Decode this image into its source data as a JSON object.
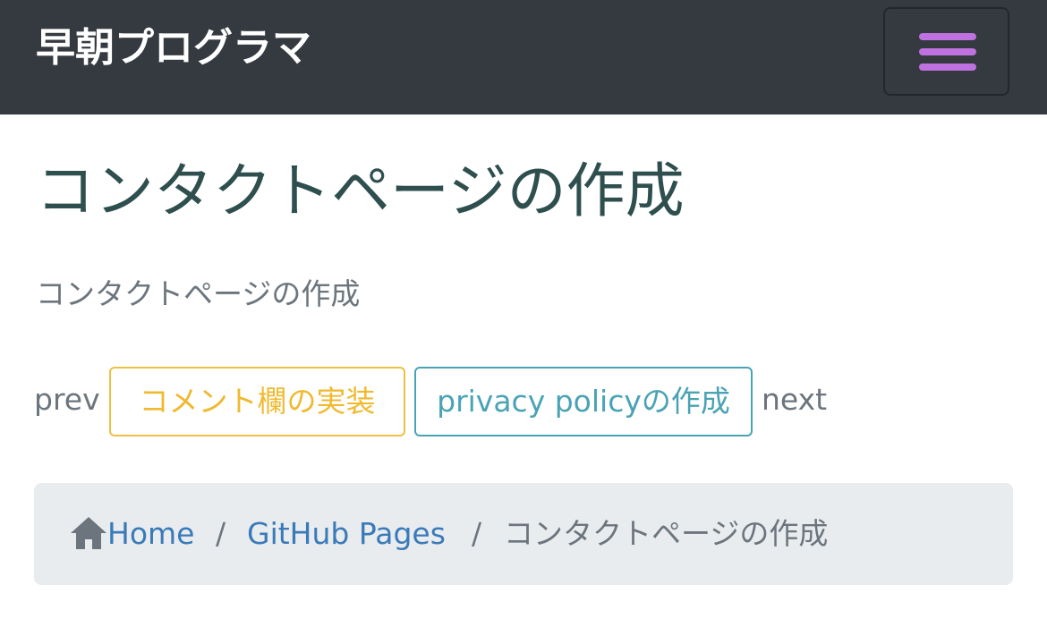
{
  "navbar": {
    "brand": "早朝プログラマ",
    "toggler_icon": "hamburger-menu-icon",
    "toggler_color": "#c071e0"
  },
  "page": {
    "title": "コンタクトページの作成",
    "lead": "コンタクトページの作成"
  },
  "pager": {
    "prev_label": "prev",
    "prev_button": "コメント欄の実装",
    "next_button": "privacy policyの作成",
    "next_label": "next",
    "prev_color": "#f0c040",
    "next_color": "#4aa3b5"
  },
  "breadcrumb": {
    "home_icon": "home-icon",
    "items": [
      {
        "label": "Home"
      },
      {
        "label": "GitHub Pages"
      },
      {
        "label": "コンタクトページの作成"
      }
    ],
    "separator": "/"
  },
  "colors": {
    "navbar_bg": "#343a40",
    "title": "#2f4f4f",
    "muted": "#6c757d",
    "link": "#3a7ab8",
    "breadcrumb_bg": "#e9ecef"
  }
}
